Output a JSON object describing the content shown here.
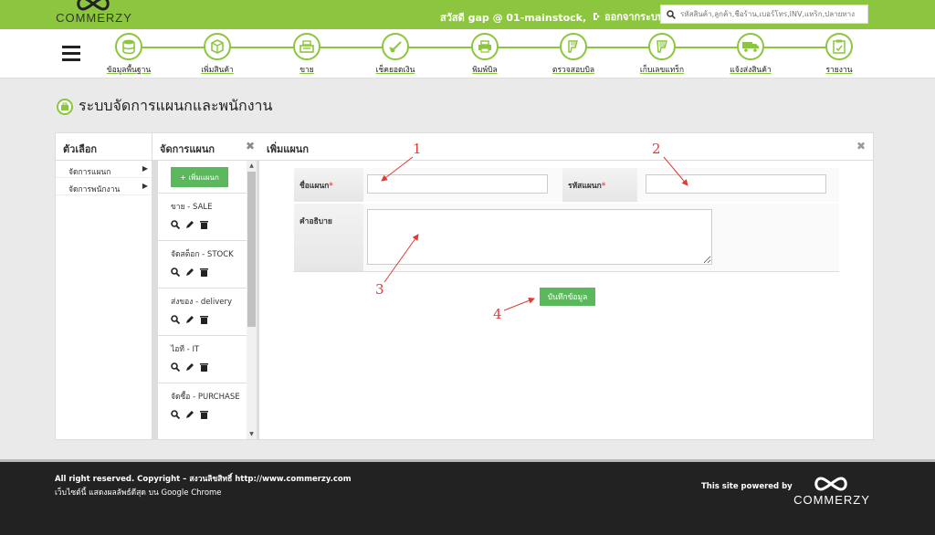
{
  "header": {
    "brand": "COMMERZY",
    "greeting": "สวัสดี gap @ 01-mainstock,",
    "logout_label": "ออกจากระบบ",
    "search_placeholder": "รหัสสินค้า,ลูกค้า,ชื่อร้าน,เบอร์โทร,INV,แทร็ก,ปลายทาง"
  },
  "nav": {
    "items": [
      {
        "label": "ข้อมูลพื้นฐาน",
        "icon": "database-icon"
      },
      {
        "label": "เพิ่มสินค้า",
        "icon": "box-icon"
      },
      {
        "label": "ขาย",
        "icon": "cash-register-icon"
      },
      {
        "label": "เช็คยอดเงิน",
        "icon": "check-money-icon"
      },
      {
        "label": "พิมพ์บิล",
        "icon": "printer-icon"
      },
      {
        "label": "ตรวจสอบบิล",
        "icon": "scanner-icon"
      },
      {
        "label": "เก็บเลขแทร็ก",
        "icon": "barcode-scanner-icon"
      },
      {
        "label": "แจ้งส่งสินค้า",
        "icon": "truck-icon"
      },
      {
        "label": "รายงาน",
        "icon": "report-icon"
      }
    ]
  },
  "page": {
    "title": "ระบบจัดการแผนกและพนักงาน"
  },
  "options": {
    "heading": "ตัวเลือก",
    "items": [
      {
        "label": "จัดการแผนก"
      },
      {
        "label": "จัดการพนักงาน"
      }
    ]
  },
  "departments": {
    "heading": "จัดการแผนก",
    "add_label": "+ เพิ่มแผนก",
    "items": [
      {
        "name": "ขาย - SALE"
      },
      {
        "name": "จัดสต็อก - STOCK"
      },
      {
        "name": "ส่งของ - delivery"
      },
      {
        "name": "ไอที - IT"
      },
      {
        "name": "จัดซื้อ - PURCHASE"
      }
    ]
  },
  "form": {
    "heading": "เพิ่มแผนก",
    "name_label": "ชื่อแผนก",
    "code_label": "รหัสแผนก",
    "required_mark": "*",
    "description_label": "คำอธิบาย",
    "save_label": "บันทึกข้อมูล"
  },
  "annotations": {
    "n1": "1",
    "n2": "2",
    "n3": "3",
    "n4": "4",
    "color": "#e53935"
  },
  "footer": {
    "copyright": "All right reserved. Copyright – สงวนลิขสิทธิ์ http://www.commerzy.com",
    "browser_note": "เว็บไซต์นี้ แสดงผลลัพธ์ดีสุด บน Google Chrome",
    "powered_by": "This site powered by",
    "brand": "COMMERZY"
  },
  "colors": {
    "accent": "#8cc63f",
    "button": "#5cb85c",
    "footer": "#222222"
  }
}
